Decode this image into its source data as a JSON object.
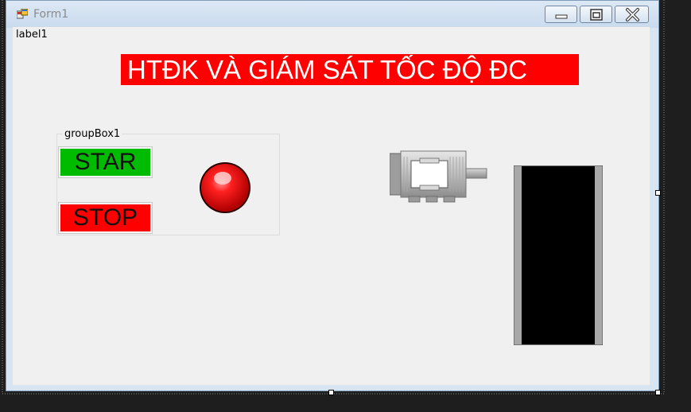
{
  "window": {
    "title": "Form1"
  },
  "form": {
    "label1": "label1",
    "heading": "HTĐK VÀ GIÁM SÁT TỐC ĐỘ ĐC",
    "groupbox_title": "groupBox1",
    "start_button": "STAR",
    "stop_button": "STOP"
  },
  "icons": {
    "app": "form-icon",
    "minimize": "minimize-icon",
    "maximize": "maximize-icon",
    "close": "close-icon",
    "lamp": "indicator-lamp",
    "motor": "electric-motor",
    "conveyor": "conveyor-belt"
  },
  "colors": {
    "heading_bg": "#ff0000",
    "heading_fg": "#ffffff",
    "start_bg": "#00bb00",
    "stop_bg": "#ff0000",
    "lamp": "#ff0000",
    "form_bg": "#f0f0f0",
    "designer_bg": "#1e1e1e"
  }
}
